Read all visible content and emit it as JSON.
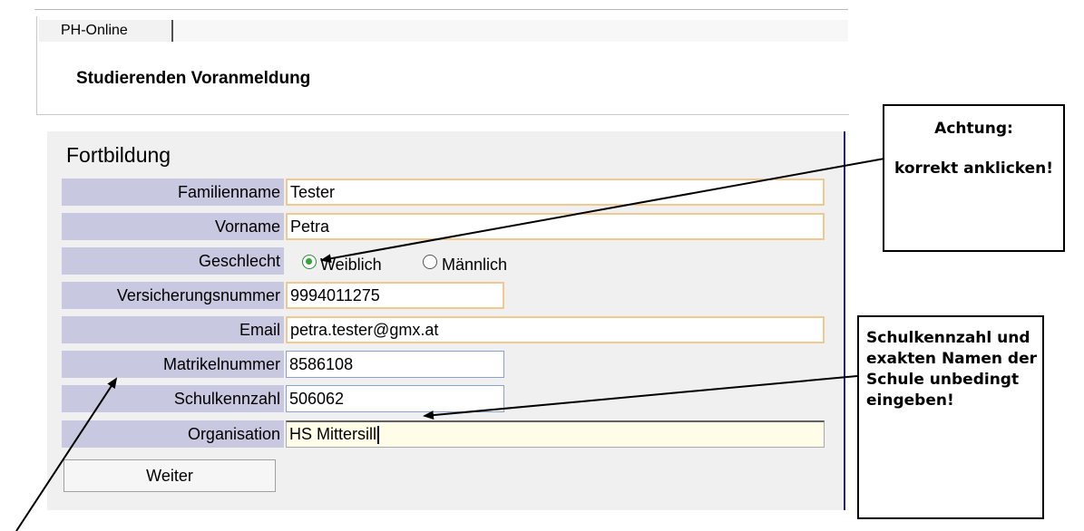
{
  "header": {
    "tab_label": "PH-Online",
    "page_title": "Studierenden Voranmeldung"
  },
  "form": {
    "section_title": "Fortbildung",
    "fields": {
      "familienname": {
        "label": "Familienname",
        "value": "Tester"
      },
      "vorname": {
        "label": "Vorname",
        "value": "Petra"
      },
      "geschlecht": {
        "label": "Geschlecht",
        "options": [
          "Weiblich",
          "Männlich"
        ],
        "selected": "Weiblich"
      },
      "versicherungsnummer": {
        "label": "Versicherungsnummer",
        "value": "9994011275"
      },
      "email": {
        "label": "Email",
        "value": "petra.tester@gmx.at"
      },
      "matrikelnummer": {
        "label": "Matrikelnummer",
        "value": "8586108"
      },
      "schulkennzahl": {
        "label": "Schulkennzahl",
        "value": "506062"
      },
      "organisation": {
        "label": "Organisation",
        "value": "HS Mittersill"
      }
    },
    "submit_label": "Weiter"
  },
  "annotations": {
    "note1": [
      "Achtung:",
      "korrekt anklicken!"
    ],
    "note2": [
      "Schulkennzahl und exakten Namen der Schule unbedingt eingeben!"
    ]
  },
  "colors": {
    "label_bg": "#c8c8e0",
    "required_border": "#f0c890",
    "radio_selected": "#2fa53a"
  }
}
